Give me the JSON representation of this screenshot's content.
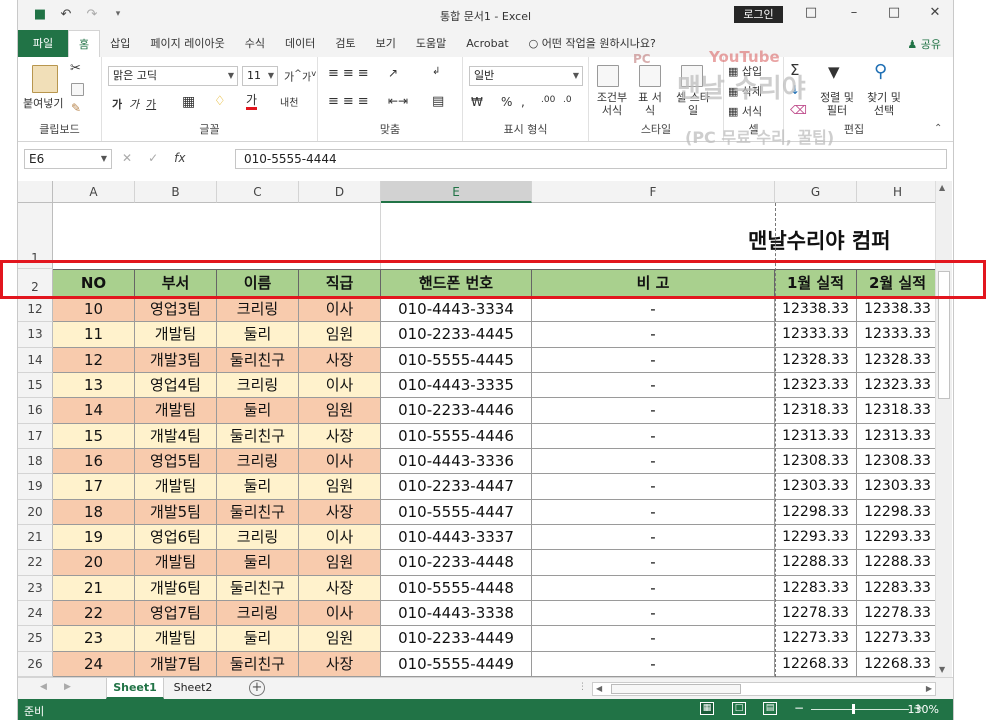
{
  "title_bar": {
    "title": "통합 문서1 - Excel",
    "login": "로그인",
    "qat": {
      "save_icon": "save-icon",
      "undo_icon": "undo-icon",
      "redo_icon": "redo-icon"
    },
    "controls": [
      "restore-ribbon-icon",
      "minimize-icon",
      "maximize-icon",
      "close-icon"
    ]
  },
  "ribbon_tabs": {
    "file": "파일",
    "tabs": [
      "홈",
      "삽입",
      "페이지 레이아웃",
      "수식",
      "데이터",
      "검토",
      "보기",
      "도움말",
      "Acrobat"
    ],
    "search": "어떤 작업을 원하시나요?",
    "share": "공유"
  },
  "ribbon": {
    "clipboard": {
      "paste": "붙여넣기",
      "label": "클립보드"
    },
    "font": {
      "name": "맑은 고딕",
      "size": "11",
      "bold": "가",
      "italic": "가",
      "underline": "가",
      "label": "글꼴"
    },
    "align": {
      "wrap": "맞춤",
      "label": "맞춤"
    },
    "number": {
      "format": "일반",
      "label": "표시 형식"
    },
    "styles": {
      "cond": "조건부 서식",
      "table": "표 서식",
      "cell": "셀 스타일",
      "label": "스타일"
    },
    "cells": {
      "insert": "삽입",
      "delete": "삭제",
      "format": "서식",
      "label": "셀"
    },
    "edit": {
      "sort": "정렬 및 필터",
      "find": "찾기 및 선택",
      "label": "편집"
    }
  },
  "formula_bar": {
    "name_box": "E6",
    "formula": "010-5555-4444"
  },
  "columns": [
    "A",
    "B",
    "C",
    "D",
    "E",
    "F",
    "G",
    "H"
  ],
  "selected_column": "E",
  "banner": "맨날수리야 컴퍼",
  "header_row": {
    "row": "2",
    "cells": [
      "NO",
      "부서",
      "이름",
      "직급",
      "핸드폰 번호",
      "비 고",
      "1월 실적",
      "2월 실적"
    ]
  },
  "top_rows": [
    "1"
  ],
  "rows": [
    {
      "row": "12",
      "no": "10",
      "dept": "영업3팀",
      "name": "크리링",
      "rank": "이사",
      "phone": "010-4443-3334",
      "note": "-",
      "m1": "12338.33",
      "m2": "12338.33"
    },
    {
      "row": "13",
      "no": "11",
      "dept": "개발팀",
      "name": "둘리",
      "rank": "임원",
      "phone": "010-2233-4445",
      "note": "-",
      "m1": "12333.33",
      "m2": "12333.33"
    },
    {
      "row": "14",
      "no": "12",
      "dept": "개발3팀",
      "name": "둘리친구",
      "rank": "사장",
      "phone": "010-5555-4445",
      "note": "-",
      "m1": "12328.33",
      "m2": "12328.33"
    },
    {
      "row": "15",
      "no": "13",
      "dept": "영업4팀",
      "name": "크리링",
      "rank": "이사",
      "phone": "010-4443-3335",
      "note": "-",
      "m1": "12323.33",
      "m2": "12323.33"
    },
    {
      "row": "16",
      "no": "14",
      "dept": "개발팀",
      "name": "둘리",
      "rank": "임원",
      "phone": "010-2233-4446",
      "note": "-",
      "m1": "12318.33",
      "m2": "12318.33"
    },
    {
      "row": "17",
      "no": "15",
      "dept": "개발4팀",
      "name": "둘리친구",
      "rank": "사장",
      "phone": "010-5555-4446",
      "note": "-",
      "m1": "12313.33",
      "m2": "12313.33"
    },
    {
      "row": "18",
      "no": "16",
      "dept": "영업5팀",
      "name": "크리링",
      "rank": "이사",
      "phone": "010-4443-3336",
      "note": "-",
      "m1": "12308.33",
      "m2": "12308.33"
    },
    {
      "row": "19",
      "no": "17",
      "dept": "개발팀",
      "name": "둘리",
      "rank": "임원",
      "phone": "010-2233-4447",
      "note": "-",
      "m1": "12303.33",
      "m2": "12303.33"
    },
    {
      "row": "20",
      "no": "18",
      "dept": "개발5팀",
      "name": "둘리친구",
      "rank": "사장",
      "phone": "010-5555-4447",
      "note": "-",
      "m1": "12298.33",
      "m2": "12298.33"
    },
    {
      "row": "21",
      "no": "19",
      "dept": "영업6팀",
      "name": "크리링",
      "rank": "이사",
      "phone": "010-4443-3337",
      "note": "-",
      "m1": "12293.33",
      "m2": "12293.33"
    },
    {
      "row": "22",
      "no": "20",
      "dept": "개발팀",
      "name": "둘리",
      "rank": "임원",
      "phone": "010-2233-4448",
      "note": "-",
      "m1": "12288.33",
      "m2": "12288.33"
    },
    {
      "row": "23",
      "no": "21",
      "dept": "개발6팀",
      "name": "둘리친구",
      "rank": "사장",
      "phone": "010-5555-4448",
      "note": "-",
      "m1": "12283.33",
      "m2": "12283.33"
    },
    {
      "row": "24",
      "no": "22",
      "dept": "영업7팀",
      "name": "크리링",
      "rank": "이사",
      "phone": "010-4443-3338",
      "note": "-",
      "m1": "12278.33",
      "m2": "12278.33"
    },
    {
      "row": "25",
      "no": "23",
      "dept": "개발팀",
      "name": "둘리",
      "rank": "임원",
      "phone": "010-2233-4449",
      "note": "-",
      "m1": "12273.33",
      "m2": "12273.33"
    },
    {
      "row": "26",
      "no": "24",
      "dept": "개발7팀",
      "name": "둘리친구",
      "rank": "사장",
      "phone": "010-5555-4449",
      "note": "-",
      "m1": "12268.33",
      "m2": "12268.33"
    }
  ],
  "row_colors": {
    "odd": "#fff2cc",
    "even": "#f8cbad",
    "header": "#a9d08e"
  },
  "sheets": [
    "Sheet1",
    "Sheet2"
  ],
  "active_sheet": "Sheet1",
  "status": {
    "ready": "준비",
    "zoom": "130%"
  },
  "watermark": {
    "line1": "PC",
    "line2": "YouTube",
    "line3": "맨날 수리야",
    "line4": "(PC 무료 수리, 꿀팁)"
  },
  "accent": "#217346",
  "highlight_color": "#e2161e"
}
